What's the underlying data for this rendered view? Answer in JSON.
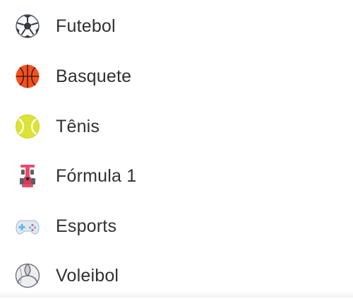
{
  "sports": [
    {
      "label": "Futebol",
      "icon": "soccer-ball-icon"
    },
    {
      "label": "Basquete",
      "icon": "basketball-icon"
    },
    {
      "label": "Tênis",
      "icon": "tennis-ball-icon"
    },
    {
      "label": "Fórmula 1",
      "icon": "formula-1-car-icon"
    },
    {
      "label": "Esports",
      "icon": "gamepad-icon"
    },
    {
      "label": "Voleibol",
      "icon": "volleyball-icon"
    }
  ],
  "colors": {
    "text": "#303030",
    "basketball": "#f4511e",
    "tennis": "#dce335",
    "formula_1": "#e84c6c",
    "gamepad": "#dfe8f2"
  }
}
